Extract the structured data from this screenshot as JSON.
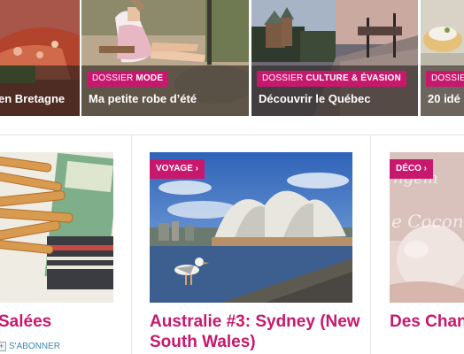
{
  "dossiers": [
    {
      "tag_prefix": "",
      "tag_theme": "",
      "caption": "en Bretagne"
    },
    {
      "tag_prefix": "DOSSIER",
      "tag_theme": "MODE",
      "caption": "Ma petite robe d’été"
    },
    {
      "tag_prefix": "DOSSIER",
      "tag_theme": "CULTURE & ÉVASION",
      "caption": "Découvrir le Québec"
    },
    {
      "tag_prefix": "DOSSIER",
      "tag_theme": "",
      "caption": "20 idé"
    }
  ],
  "articles": [
    {
      "category": "",
      "title": "Salées"
    },
    {
      "category": "VOYAGE ›",
      "title": "Australie #3: Sydney (New South Wales)"
    },
    {
      "category": "DÉCO ›",
      "title": "Des Chang Cocon…"
    }
  ],
  "subscribe": {
    "label": "S'ABONNER"
  },
  "colors": {
    "accent": "#c8186e",
    "link": "#3a87b4"
  }
}
